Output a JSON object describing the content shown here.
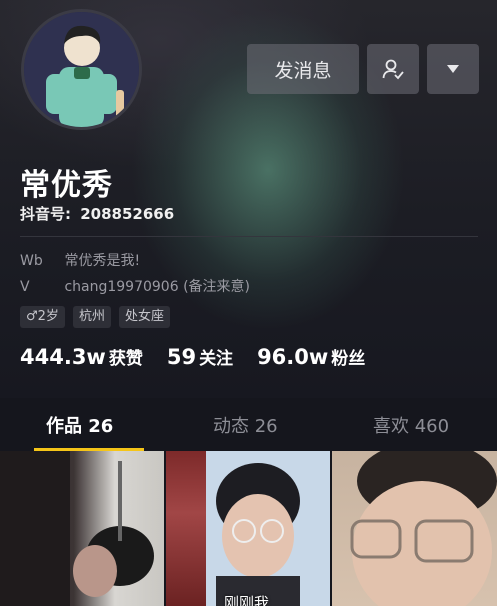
{
  "profile": {
    "name": "常优秀",
    "douyin_id_label": "抖音号:",
    "douyin_id": "208852666",
    "bio": {
      "line1_prefix": "Wb",
      "line1_text": "常优秀是我!",
      "line2_prefix": "V",
      "line2_text": "chang19970906 (备注来意)"
    },
    "tags": [
      "♂2岁",
      "杭州",
      "处女座"
    ]
  },
  "actions": {
    "message_label": "发消息",
    "follow_icon": "user-check-icon",
    "more_icon": "caret-down-icon"
  },
  "stats": [
    {
      "value": "444.3w",
      "label": "获赞"
    },
    {
      "value": "59",
      "label": "关注"
    },
    {
      "value": "96.0w",
      "label": "粉丝"
    }
  ],
  "tabs": [
    {
      "label": "作品 26",
      "active": true
    },
    {
      "label": "动态 26",
      "active": false
    },
    {
      "label": "喜欢 460",
      "active": false
    }
  ],
  "videos": [
    {
      "caption": ""
    },
    {
      "caption": "刚刚我"
    },
    {
      "caption": ""
    }
  ],
  "colors": {
    "accent": "#f5c518",
    "background": "#15161d",
    "button_bg": "#5f5f66"
  }
}
